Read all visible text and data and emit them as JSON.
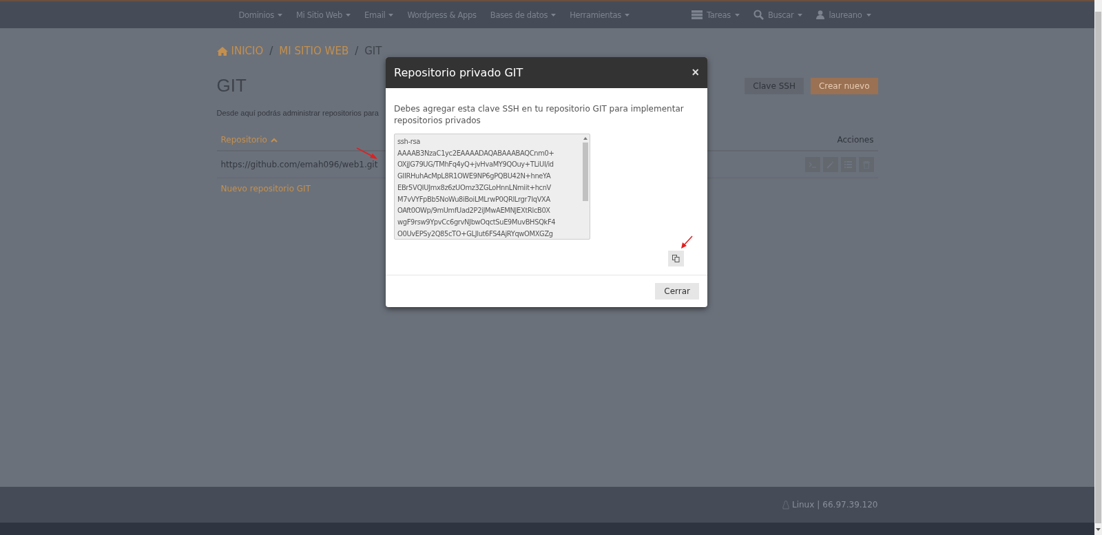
{
  "navbar": {
    "menu": [
      {
        "label": "Dominios",
        "dropdown": true
      },
      {
        "label": "Mi Sitio Web",
        "dropdown": true
      },
      {
        "label": "Email",
        "dropdown": true
      },
      {
        "label": "Wordpress & Apps",
        "dropdown": false
      },
      {
        "label": "Bases de datos",
        "dropdown": true
      },
      {
        "label": "Herramientas",
        "dropdown": true
      }
    ],
    "right": [
      {
        "kind": "tasks",
        "label": "Tareas"
      },
      {
        "kind": "search",
        "label": "Buscar"
      },
      {
        "kind": "user",
        "label": "laureano"
      }
    ]
  },
  "breadcrumb": [
    "INICIO",
    "MI SITIO WEB",
    "GIT"
  ],
  "breadcrumb_separator": "/",
  "page": {
    "title": "GIT",
    "description": "Desde aquí podrás administrar repositorios para",
    "buttons": [
      {
        "label": "Clave SSH",
        "kind": "default"
      },
      {
        "label": "Crear nuevo",
        "kind": "primary"
      }
    ]
  },
  "table": {
    "columns": [
      "Repositorio",
      "Acciones"
    ],
    "rows": [
      {
        "repository": "https://github.com/emah096/web1.git",
        "actions": [
          {
            "kind": "terminal"
          },
          {
            "kind": "edit"
          },
          {
            "kind": "list"
          },
          {
            "kind": "delete"
          }
        ]
      }
    ],
    "add_link": "Nuevo repositorio GIT"
  },
  "modal": {
    "title": "Repositorio privado GIT",
    "close": "×",
    "message": "Debes agregar esta clave SSH en tu repositorio GIT para implementar repositorios privados",
    "ssh_key": "ssh-rsa\nAAAAB3NzaC1yc2EAAAADAQABAAABAQCnm0+\nOXjJG79UG/TMhFq4yQ+jvHvaMY9QOuy+TLiUI/id\nGIIRHuhAcMpL8R1OWE9NP6gPQBU42N+hneYA\nEBr5VQlUJmx8z6zUOmz3ZGLoHnnLNmiit+hcnV\nM7vVYFpBb5NoWu8iBoiLMLrwP0QRlLrgr7IqVXA\nOAft0OWp/9mUmfUad2P2iJMwAEMNJEXtRlcB0X\nwgF9rsw9YpvCc6grvNJbwOqctSuE9MuvBHSQkF4\nO0UvEPSy2Q85cTO+GLJlut6FS4AjRYqwOMXGZg",
    "footer_button": "Cerrar"
  },
  "footer": {
    "os": "Linux",
    "separator": "|",
    "ip": "66.97.39.120"
  }
}
